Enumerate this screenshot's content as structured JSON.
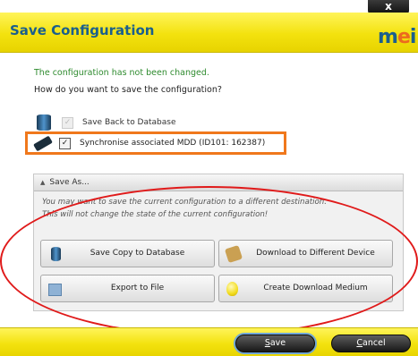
{
  "window": {
    "title": "Save Configuration",
    "close_glyph": "x"
  },
  "logo": {
    "text_main": "m",
    "text_dot": "e",
    "text_end": "i"
  },
  "status_message": "The configuration has not been changed.",
  "question": "How do you want to save the configuration?",
  "options": [
    {
      "label": "Save Back to Database",
      "checked": true,
      "enabled": false,
      "icon": "database-icon"
    },
    {
      "label": "Synchronise associated MDD (ID101: 162387)",
      "checked": true,
      "enabled": true,
      "icon": "mdd-device-icon"
    }
  ],
  "save_as": {
    "header": "Save As...",
    "expanded": true,
    "note_line1": "You may want to save the current configuration to a different destination.",
    "note_line2": "This will not change the state of the current configuration!",
    "actions": [
      {
        "label": "Save Copy to Database",
        "icon": "database-icon"
      },
      {
        "label": "Download to Different Device",
        "icon": "download-device-icon"
      },
      {
        "label": "Export to File",
        "icon": "export-file-icon"
      },
      {
        "label": "Create Download Medium",
        "icon": "download-medium-icon"
      }
    ]
  },
  "buttons": {
    "save": {
      "mnemonic": "S",
      "rest": "ave"
    },
    "cancel": {
      "mnemonic": "C",
      "rest": "ancel"
    }
  },
  "colors": {
    "title_blue": "#1a5f8d",
    "header_yellow": "#f3e20e",
    "status_green": "#2f8b2f",
    "highlight_orange": "#f0781c",
    "ellipse_red": "#e01a1a"
  }
}
